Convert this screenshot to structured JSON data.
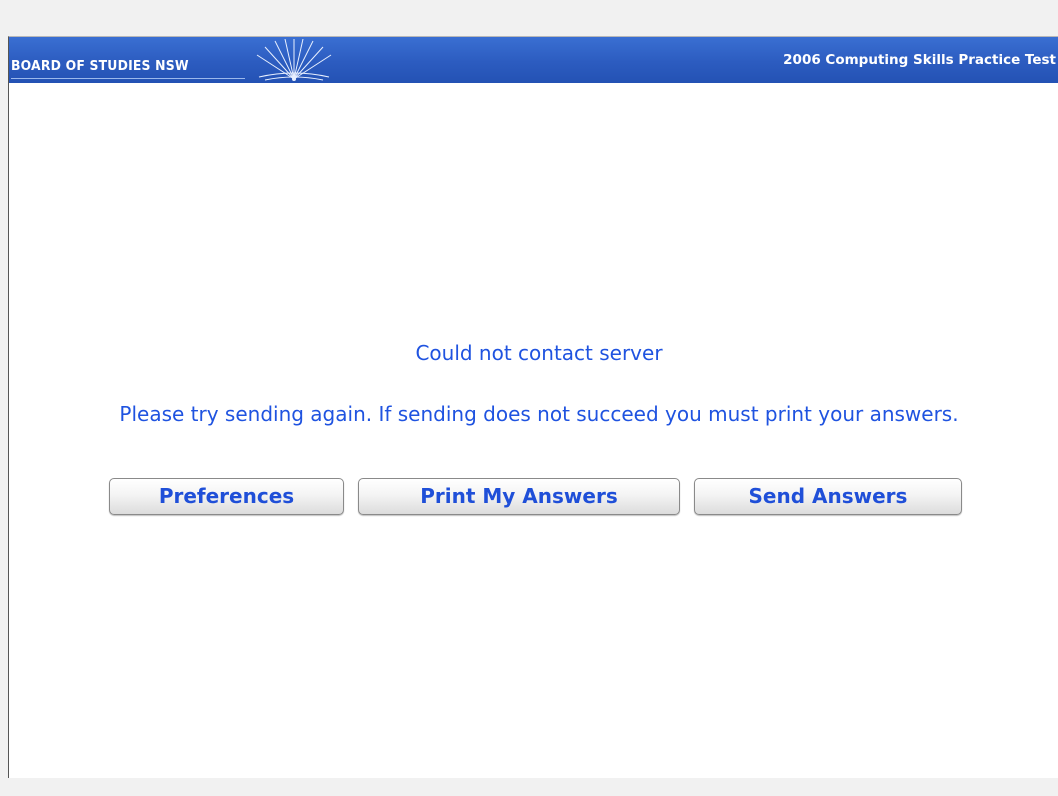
{
  "header": {
    "brand": "BOARD OF STUDIES NSW",
    "test_title": "2006 Computing Skills Practice Test",
    "logo_icon": "sunburst-book-logo-icon"
  },
  "message": {
    "title": "Could not contact server",
    "body": "Please try sending again. If sending does not succeed you must print your answers."
  },
  "buttons": {
    "preferences": "Preferences",
    "print": "Print My Answers",
    "send": "Send Answers"
  },
  "colors": {
    "header_blue": "#2c5cc0",
    "text_blue": "#1f53e0",
    "button_text": "#1f4fd8"
  }
}
